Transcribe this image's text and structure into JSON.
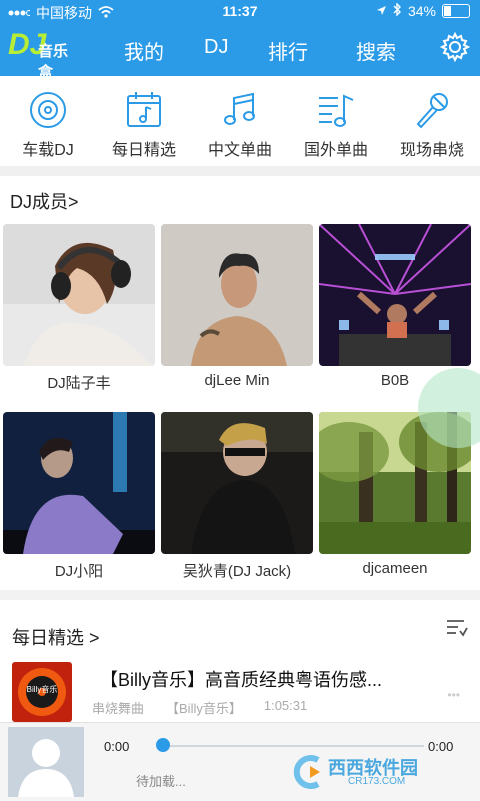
{
  "status_bar": {
    "carrier": "中国移动",
    "time": "11:37",
    "battery": "34%",
    "battery_fraction": 0.34
  },
  "nav": {
    "logo_text": "音乐盒",
    "logo_dj": "DJ",
    "items": [
      "我的",
      "DJ",
      "排行",
      "搜索"
    ]
  },
  "categories": [
    {
      "label": "车载DJ",
      "icon": "disc-icon"
    },
    {
      "label": "每日精选",
      "icon": "calendar-music-icon"
    },
    {
      "label": "中文单曲",
      "icon": "music-note-icon"
    },
    {
      "label": "国外单曲",
      "icon": "playlist-icon"
    },
    {
      "label": "现场串烧",
      "icon": "microphone-icon"
    }
  ],
  "dj_members": {
    "title": "DJ成员>",
    "members": [
      {
        "name": "DJ陆子丰"
      },
      {
        "name": "djLee Min"
      },
      {
        "name": "B0B"
      },
      {
        "name": "DJ小阳"
      },
      {
        "name": "吴狄青(DJ Jack)"
      },
      {
        "name": "djcameen"
      }
    ]
  },
  "daily": {
    "title": "每日精选 >",
    "item": {
      "title": "【Billy音乐】高音质经典粤语伤感...",
      "genre": "串烧舞曲",
      "artist": "【Billy音乐】",
      "duration": "1:05:31",
      "thumb_label": "Billy音乐"
    }
  },
  "player": {
    "current_time": "0:00",
    "total_time": "0:00",
    "status": "待加载...",
    "progress": 0
  },
  "watermark": {
    "site": "西西软件园",
    "url": "CR173.COM"
  },
  "colors": {
    "primary": "#2b9be8",
    "logo_green": "#b7ee35"
  }
}
